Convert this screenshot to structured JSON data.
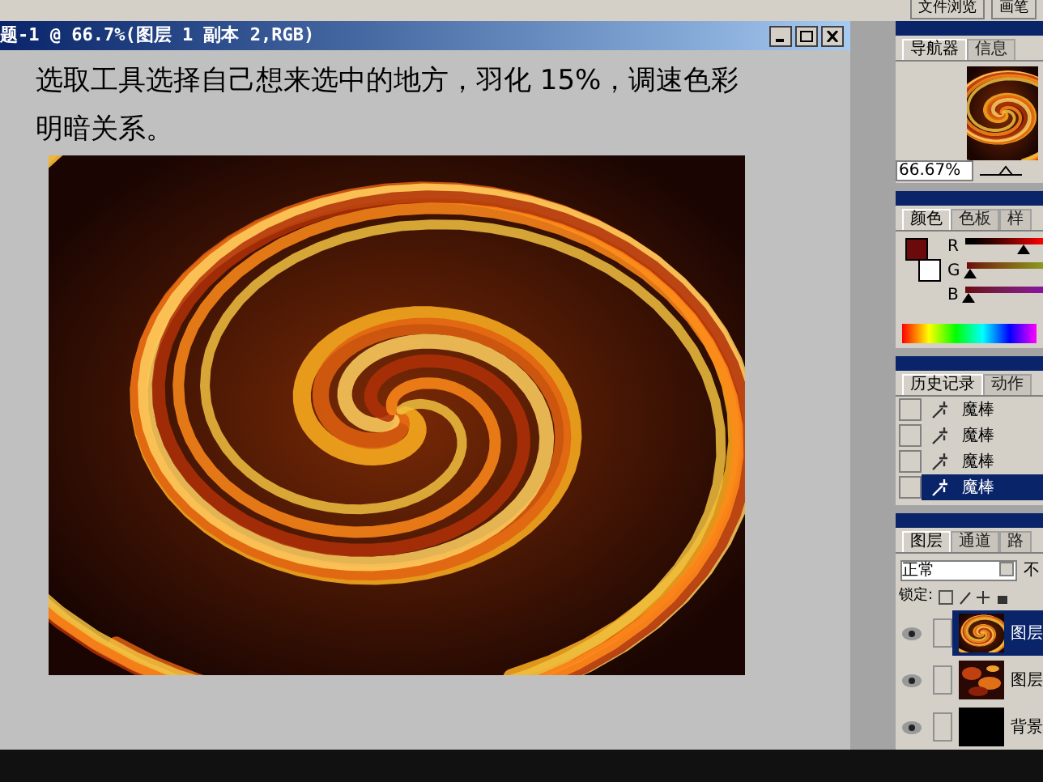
{
  "toolbar": {
    "tabs": [
      "文件浏览",
      "画笔"
    ]
  },
  "document": {
    "title": "题-1 @ 66.7%(图层 1 副本 2,RGB)",
    "caption": [
      "选取工具选择自己想来选中的地方，羽化 15%，调速色彩",
      "明暗关系。"
    ]
  },
  "navigator": {
    "tabs": [
      {
        "label": "导航器",
        "selected": true
      },
      {
        "label": "信息",
        "selected": false
      }
    ],
    "zoom": "66.67%"
  },
  "color": {
    "tabs": [
      {
        "label": "颜色",
        "selected": true
      },
      {
        "label": "色板",
        "selected": false
      },
      {
        "label": "样",
        "selected": false
      }
    ],
    "channels": [
      {
        "label": "R",
        "level": 0.75
      },
      {
        "label": "G",
        "level": 0.05
      },
      {
        "label": "B",
        "level": 0.05
      }
    ]
  },
  "history": {
    "tabs": [
      {
        "label": "历史记录",
        "selected": true
      },
      {
        "label": "动作",
        "selected": false
      }
    ],
    "items": [
      {
        "label": "魔棒",
        "selected": false
      },
      {
        "label": "魔棒",
        "selected": false
      },
      {
        "label": "魔棒",
        "selected": false
      },
      {
        "label": "魔棒",
        "selected": true
      }
    ]
  },
  "layers": {
    "tabs": [
      {
        "label": "图层",
        "selected": true
      },
      {
        "label": "通道",
        "selected": false
      },
      {
        "label": "路",
        "selected": false
      }
    ],
    "blend_mode": "正常",
    "opacity_label": "不",
    "lock_label": "锁定:",
    "items": [
      {
        "name": "图层",
        "selected": true,
        "kind": "swirl"
      },
      {
        "name": "图层",
        "selected": false,
        "kind": "fire"
      },
      {
        "name": "背景",
        "selected": false,
        "kind": "black"
      }
    ]
  }
}
